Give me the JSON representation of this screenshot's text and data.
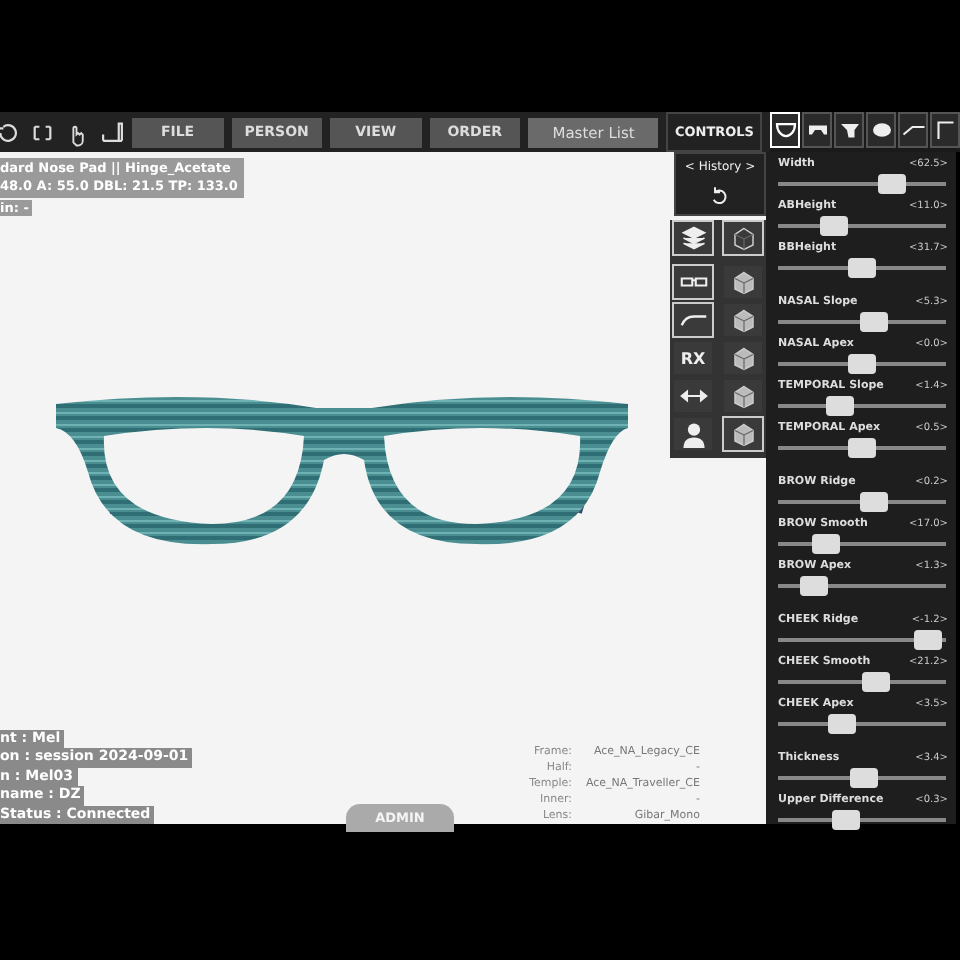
{
  "toolbar": {
    "tools": [
      {
        "kind": "refresh"
      },
      {
        "kind": "frame"
      },
      {
        "kind": "hand"
      },
      {
        "kind": "ruler"
      }
    ],
    "menus": [
      {
        "label": "FILE",
        "selected": false
      },
      {
        "label": "PERSON",
        "selected": false
      },
      {
        "label": "VIEW",
        "selected": false
      },
      {
        "label": "ORDER",
        "selected": false
      },
      {
        "label": "Master List",
        "selected": true
      }
    ],
    "controls_label": "CONTROLS"
  },
  "viewport": {
    "info_top": [
      "dard Nose Pad || Hinge_Acetate",
      "48.0  A: 55.0  DBL: 21.5  TP: 133.0"
    ],
    "info_extra": "in: -",
    "info_bottom": [
      "nt : Mel",
      "on : session 2024-09-01",
      "n : Mel03",
      "name : DZ",
      "Status : Connected"
    ],
    "parts": [
      {
        "label": "Frame:",
        "value": "Ace_NA_Legacy_CE"
      },
      {
        "label": "Half:",
        "value": "-"
      },
      {
        "label": "Temple:",
        "value": "Ace_NA_Traveller_CE"
      },
      {
        "label": "Inner:",
        "value": "-"
      },
      {
        "label": "Lens:",
        "value": "Gibar_Mono"
      }
    ],
    "admin_tab": "ADMIN"
  },
  "history": {
    "label": "< History >"
  },
  "tools_left": [
    {
      "kind": "layers",
      "selected": true
    },
    {
      "kind": "glasses",
      "selected": true
    },
    {
      "kind": "curve",
      "selected": true
    },
    {
      "kind": "text",
      "text": "RX",
      "selected": false
    },
    {
      "kind": "width",
      "selected": false
    },
    {
      "kind": "person",
      "selected": false
    }
  ],
  "tools_right": [
    {
      "selected": true
    },
    {
      "selected": false
    },
    {
      "selected": false
    },
    {
      "selected": false
    },
    {
      "selected": false
    },
    {
      "selected": true
    }
  ],
  "panel_tabs": [
    {
      "kind": "frame",
      "selected": true
    },
    {
      "kind": "bridge",
      "selected": false
    },
    {
      "kind": "nose",
      "selected": false
    },
    {
      "kind": "lens",
      "selected": false
    },
    {
      "kind": "temple",
      "selected": false
    },
    {
      "kind": "corner",
      "selected": false
    }
  ],
  "slider_groups": [
    {
      "sliders": [
        {
          "label": "Width",
          "value": "<62.5>",
          "level": 0.72
        },
        {
          "label": "ABHeight",
          "value": "<11.0>",
          "level": 0.3
        },
        {
          "label": "BBHeight",
          "value": "<31.7>",
          "level": 0.5
        }
      ]
    },
    {
      "sliders": [
        {
          "label": "NASAL Slope",
          "value": "<5.3>",
          "level": 0.58
        },
        {
          "label": "NASAL Apex",
          "value": "<0.0>",
          "level": 0.5
        },
        {
          "label": "TEMPORAL Slope",
          "value": "<1.4>",
          "level": 0.34
        },
        {
          "label": "TEMPORAL Apex",
          "value": "<0.5>",
          "level": 0.5
        }
      ]
    },
    {
      "sliders": [
        {
          "label": "BROW Ridge",
          "value": "<0.2>",
          "level": 0.58
        },
        {
          "label": "BROW Smooth",
          "value": "<17.0>",
          "level": 0.24
        },
        {
          "label": "BROW Apex",
          "value": "<1.3>",
          "level": 0.15
        }
      ]
    },
    {
      "sliders": [
        {
          "label": "CHEEK Ridge",
          "value": "<-1.2>",
          "level": 0.97
        },
        {
          "label": "CHEEK Smooth",
          "value": "<21.2>",
          "level": 0.6
        },
        {
          "label": "CHEEK Apex",
          "value": "<3.5>",
          "level": 0.36
        }
      ]
    },
    {
      "sliders": [
        {
          "label": "Thickness",
          "value": "<3.4>",
          "level": 0.52
        },
        {
          "label": "Upper Difference",
          "value": "<0.3>",
          "level": 0.38
        }
      ]
    }
  ]
}
